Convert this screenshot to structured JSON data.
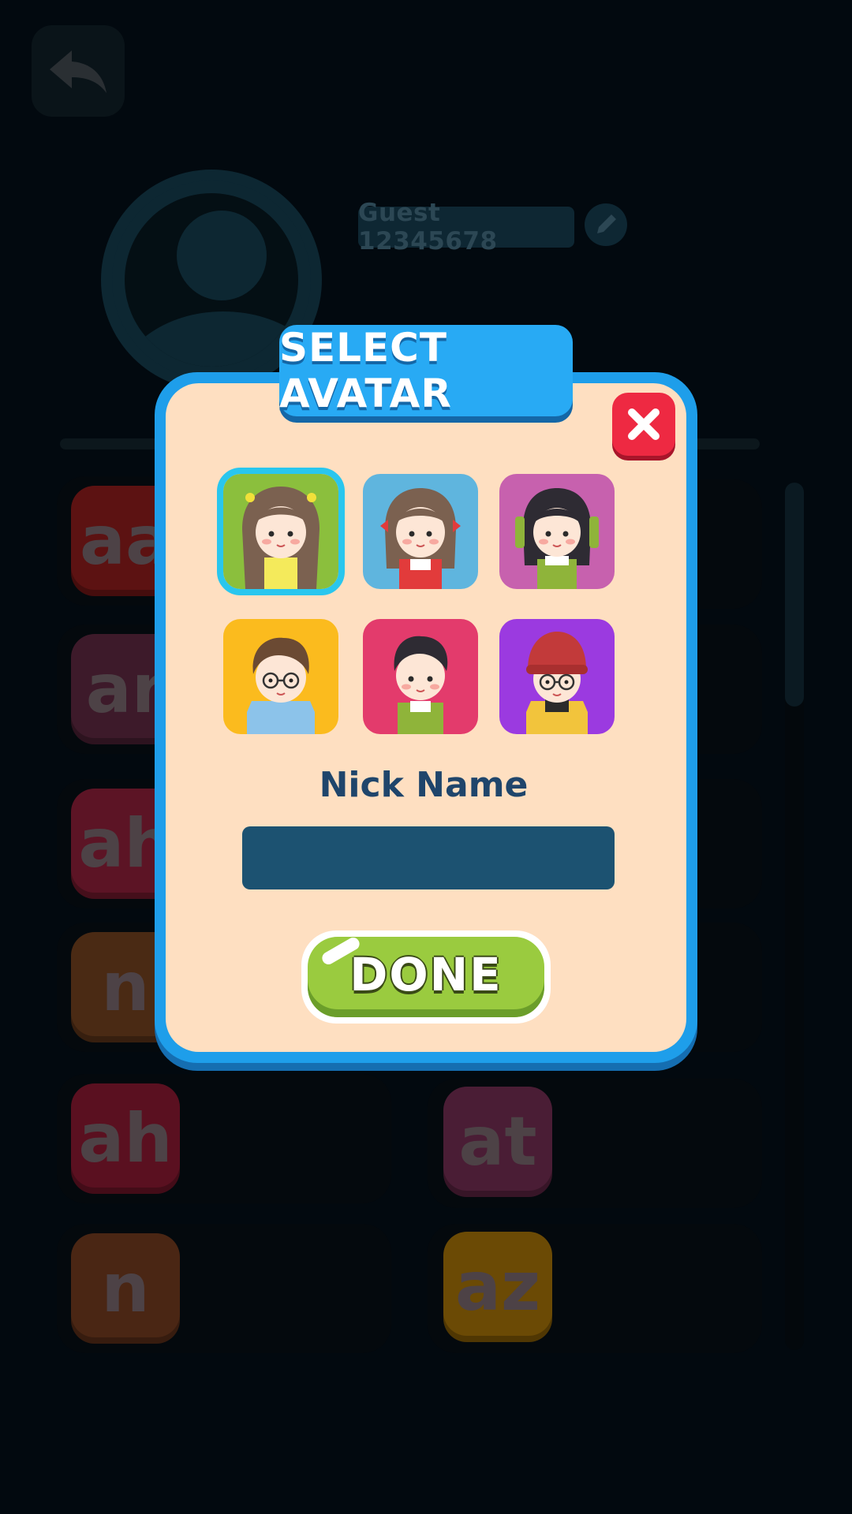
{
  "background": {
    "guest_name": "Guest 12345678",
    "word_cards": [
      {
        "text": "aa",
        "color": "#5c1212"
      },
      {
        "text": "ar",
        "color": "#3d1a2a"
      },
      {
        "text": "ah",
        "color": "#5c1425"
      },
      {
        "text": "n",
        "color": "#4a2a14"
      },
      {
        "text": "ah",
        "color": "#5a1020"
      },
      {
        "text": "n",
        "color": "#4a2614"
      },
      {
        "text": "at",
        "color": "#4a1d35"
      },
      {
        "text": "az",
        "color": "#6b4a05"
      }
    ]
  },
  "popup": {
    "title": "SELECT AVATAR",
    "avatars": [
      {
        "name": "girl-brown-hair-yellow",
        "bg": "#8bbf3d",
        "selected": true
      },
      {
        "name": "girl-red-bows",
        "bg": "#5fb5de",
        "selected": false
      },
      {
        "name": "girl-green-bows",
        "bg": "#c761ae",
        "selected": false
      },
      {
        "name": "boy-glasses-blue-shirt",
        "bg": "#fbbb1e",
        "selected": false
      },
      {
        "name": "boy-green-overalls",
        "bg": "#e33b6c",
        "selected": false
      },
      {
        "name": "boy-red-beanie",
        "bg": "#9b3ae0",
        "selected": false
      }
    ],
    "nick_label": "Nick Name",
    "nick_value": "",
    "done_label": "DONE"
  }
}
